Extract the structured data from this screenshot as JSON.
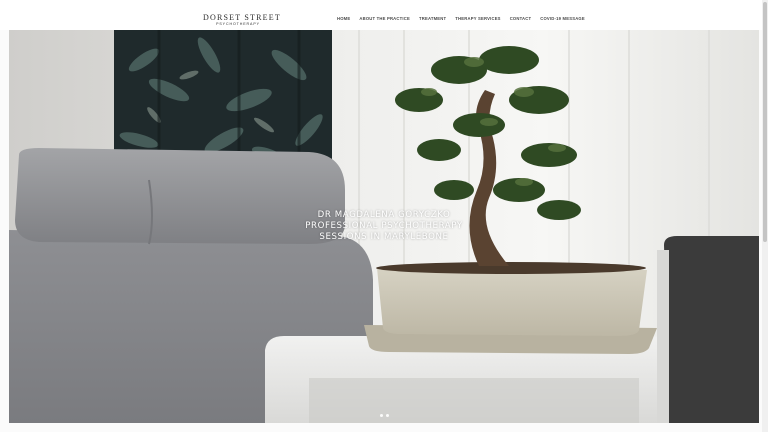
{
  "brand": {
    "name": "DORSET STREET",
    "tagline": "PSYCHOTHERAPY"
  },
  "nav": {
    "items": [
      {
        "label": "HOME"
      },
      {
        "label": "ABOUT THE PRACTICE"
      },
      {
        "label": "TREATMENT"
      },
      {
        "label": "THERAPY SERVICES"
      },
      {
        "label": "CONTACT"
      },
      {
        "label": "COVID-19 MESSAGE"
      }
    ]
  },
  "hero": {
    "line1": "DR MAGDALENA GORYCZKO",
    "line2": "PROFESSIONAL PSYCHOTHERAPY",
    "line3": "SESSIONS IN MARYLEBONE",
    "slide_count": 2
  },
  "colors": {
    "text_dark": "#2d2d2d",
    "nav_text": "#4a4a4a",
    "hero_text": "#ffffff"
  }
}
